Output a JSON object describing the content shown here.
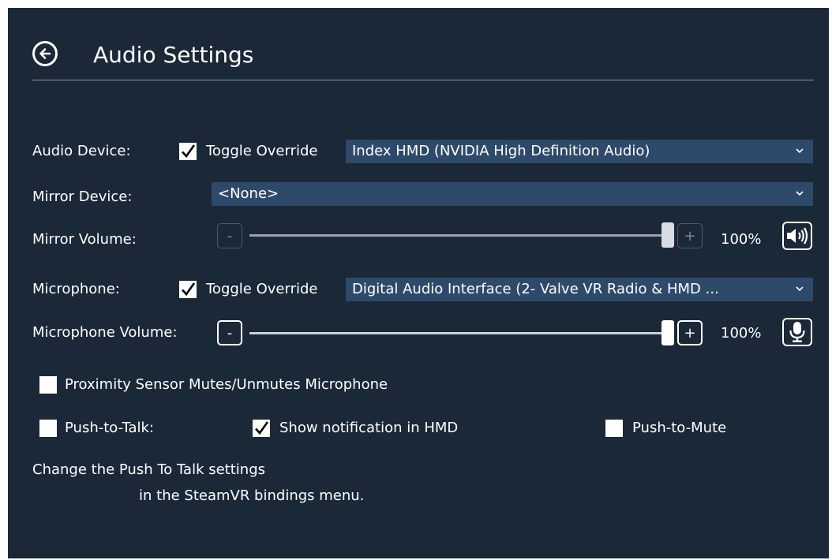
{
  "header": {
    "title": "Audio Settings",
    "back_icon": "back-arrow-circle-icon"
  },
  "audio_device": {
    "label": "Audio Device:",
    "override_checked": true,
    "override_label": "Toggle Override",
    "selected": "Index HMD (NVIDIA High Definition Audio)"
  },
  "mirror_device": {
    "label": "Mirror Device:",
    "selected": "<None>"
  },
  "mirror_volume": {
    "label": "Mirror Volume:",
    "minus": "-",
    "plus": "+",
    "value_text": "100%",
    "level": 1.0,
    "enabled": false,
    "icon": "speaker-icon"
  },
  "microphone": {
    "label": "Microphone:",
    "override_checked": true,
    "override_label": "Toggle Override",
    "selected": "Digital Audio Interface (2- Valve VR Radio & HMD ..."
  },
  "microphone_volume": {
    "label": "Microphone Volume:",
    "minus": "-",
    "plus": "+",
    "value_text": "100%",
    "level": 1.0,
    "enabled": true,
    "icon": "microphone-icon"
  },
  "proximity": {
    "label": "Proximity Sensor Mutes/Unmutes Microphone",
    "checked": false
  },
  "push_to_talk": {
    "label": "Push-to-Talk:",
    "checked": false
  },
  "show_notification": {
    "label": "Show notification in HMD",
    "checked": true
  },
  "push_to_mute": {
    "label": "Push-to-Mute",
    "checked": false
  },
  "note": {
    "line1": "Change the Push To Talk settings",
    "line2": "in the SteamVR bindings menu."
  },
  "colors": {
    "panel_bg": "#1b2838",
    "dropdown_bg": "#2e4a6a",
    "text": "#ffffff"
  }
}
